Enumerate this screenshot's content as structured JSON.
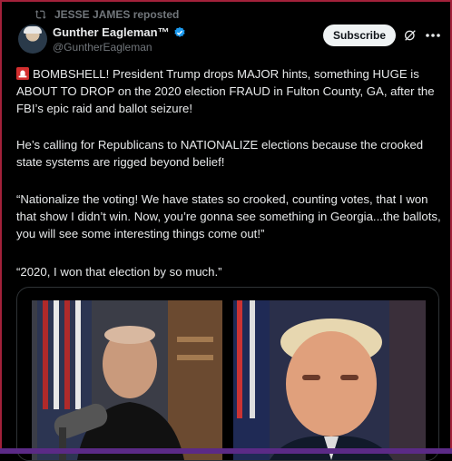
{
  "repost": {
    "text": "JESSE JAMES reposted",
    "icon": "repost-icon"
  },
  "author": {
    "name": "Gunther Eagleman™",
    "handle": "@GuntherEagleman",
    "verified": true,
    "verified_color": "#1d9bf0"
  },
  "actions": {
    "subscribe_label": "Subscribe"
  },
  "post": {
    "p1": "BOMBSHELL! President Trump drops MAJOR hints, something HUGE is ABOUT TO DROP on the 2020 election FRAUD in Fulton County, GA, after the FBI’s epic raid and ballot seizure!",
    "p2": "He’s calling for Republicans to NATIONALIZE elections because the crooked state systems are rigged beyond belief!",
    "p3": "“Nationalize the voting! We have states so crooked, counting votes, that I won that show I didn’t win. Now, you’re gonna see something in Georgia...the ballots, you will see some interesting things come out!”",
    "p4": "“2020, I won that election by so much.”"
  },
  "colors": {
    "background": "#000000",
    "text": "#e7e9ea",
    "muted": "#71767b",
    "frame": "#a3213a"
  }
}
